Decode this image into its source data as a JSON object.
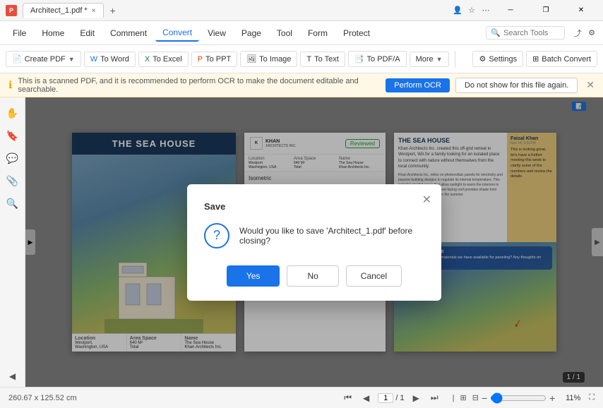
{
  "titlebar": {
    "app_name": "PDF",
    "tab_title": "Architect_1.pdf *",
    "tab_close": "×",
    "add_tab": "+",
    "icons": [
      "profile",
      "bookmark",
      "more",
      "minimize",
      "restore",
      "close"
    ]
  },
  "menubar": {
    "items": [
      "Home",
      "Edit",
      "Comment",
      "Convert",
      "View",
      "Page",
      "Tool",
      "Form",
      "Protect"
    ],
    "active": "Convert",
    "search_placeholder": "Search Tools"
  },
  "toolbar": {
    "buttons": [
      {
        "label": "Create PDF",
        "has_arrow": true
      },
      {
        "label": "To Word",
        "has_arrow": false
      },
      {
        "label": "To Excel",
        "has_arrow": false
      },
      {
        "label": "To PPT",
        "has_arrow": false
      },
      {
        "label": "To Image",
        "has_arrow": false
      },
      {
        "label": "To Text",
        "has_arrow": false
      },
      {
        "label": "To PDF/A",
        "has_arrow": false
      },
      {
        "label": "More",
        "has_arrow": true
      }
    ],
    "right_buttons": [
      "Settings",
      "Batch Convert"
    ]
  },
  "ocr_banner": {
    "text": "This is a scanned PDF, and it is recommended to perform OCR to make the document editable and searchable.",
    "perform_btn": "Perform OCR",
    "dismiss_btn": "Do not show for this file again."
  },
  "dialog": {
    "title": "Save",
    "message": "Would you like to save 'Architect_1.pdf' before closing?",
    "yes_label": "Yes",
    "no_label": "No",
    "cancel_label": "Cancel"
  },
  "left_page": {
    "title": "THE SEA HOUSE",
    "table": [
      {
        "label": "Location",
        "value": "Westport,\nWashington, USA"
      },
      {
        "label": "Area Space",
        "value": "640 M²\nTotal"
      },
      {
        "label": "Name",
        "value": "The Sea House\nKhan Architects Inc."
      }
    ]
  },
  "middle_page": {
    "company": "KHAN\nARCHITECTS INC.",
    "reviewed_label": "Reviewed",
    "columns": [
      "Location",
      "Area Space",
      "Name"
    ],
    "iso_label": "Isometric"
  },
  "right_page": {
    "title": "THE SEA HOUSE",
    "body_text": "Khan Architects Inc. created this off-grid retreat in Westport, WA for a family looking for an isolated place to connect with nature without themselves from the local community.",
    "note_text": "Khan Architects Inc. relies on photovoltaic panels for electricity and passive building designs to regulate its internal temperature. This includes graded areas that allow sunlight to warm the interiors in winter, while an extended west-facing roof provides shade from solar heat during evenings in the summer.",
    "side_note": {
      "author": "Faisal Khan",
      "date": "Nov 14, 2:01PM",
      "text": "This is looking great, let's have a further meeting this week to clarify some of the numbers and review the details."
    },
    "blue_note": {
      "title": "Composite vs. Wood",
      "text": "Can we look into what materials we have available for paneling? Any thoughts on composite..."
    }
  },
  "statusbar": {
    "dimensions": "260.67 x 125.52 cm",
    "page_current": "1",
    "page_total": "1",
    "page_display": "1 / 1",
    "zoom_level": "11%",
    "page_badge": "1 / 1"
  }
}
